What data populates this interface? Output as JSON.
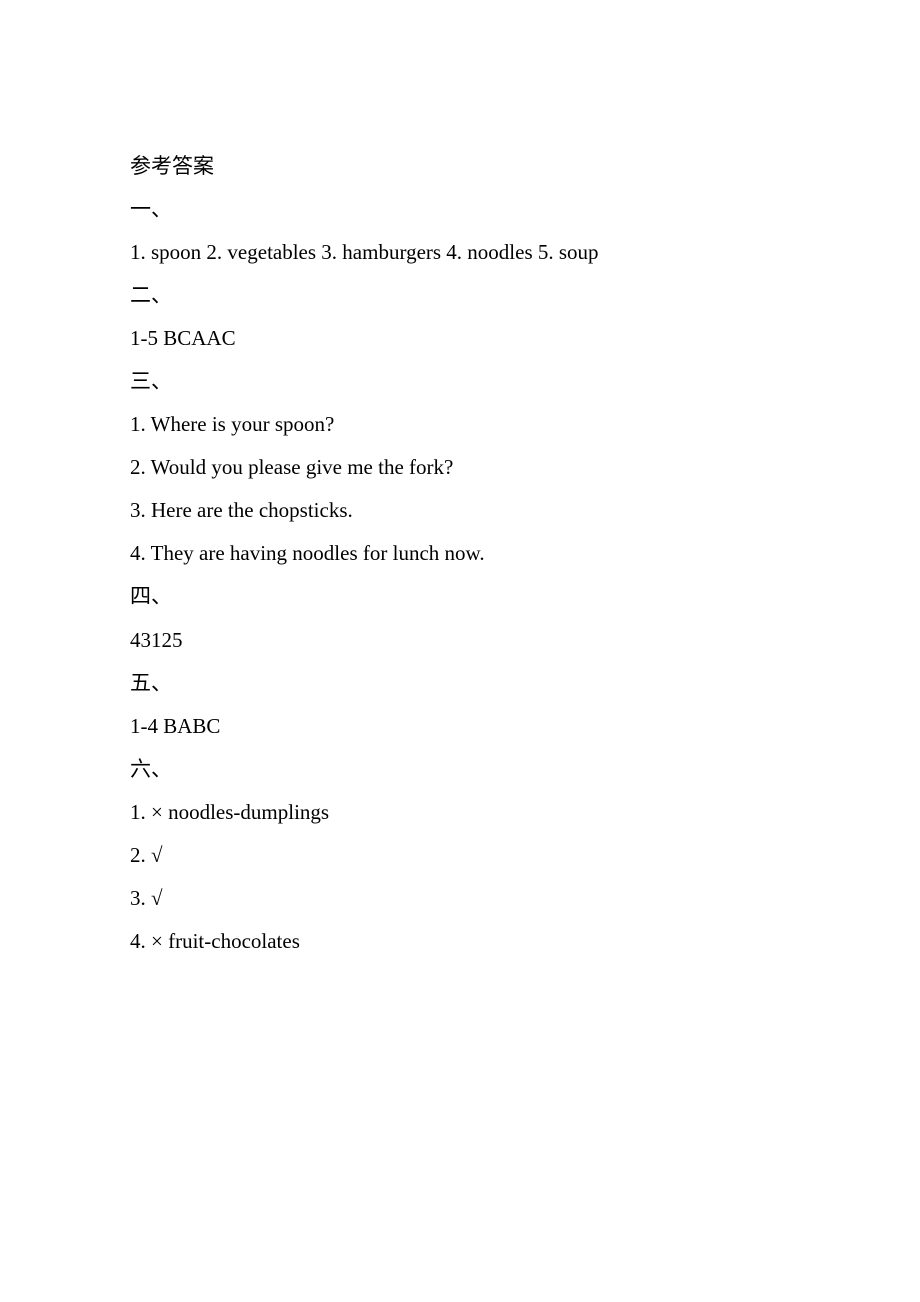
{
  "lines": [
    "参考答案",
    "一、",
    "1. spoon 2. vegetables 3. hamburgers 4. noodles 5. soup",
    "二、",
    "1-5 BCAAC",
    "三、",
    "1. Where is your spoon?",
    "2. Would you please give me the fork?",
    "3. Here are the chopsticks.",
    "4. They are having noodles for lunch now.",
    "四、",
    "43125",
    "五、",
    "1-4 BABC",
    "六、",
    "1. × noodles-dumplings",
    "2. √",
    "3. √",
    "4. × fruit-chocolates"
  ]
}
